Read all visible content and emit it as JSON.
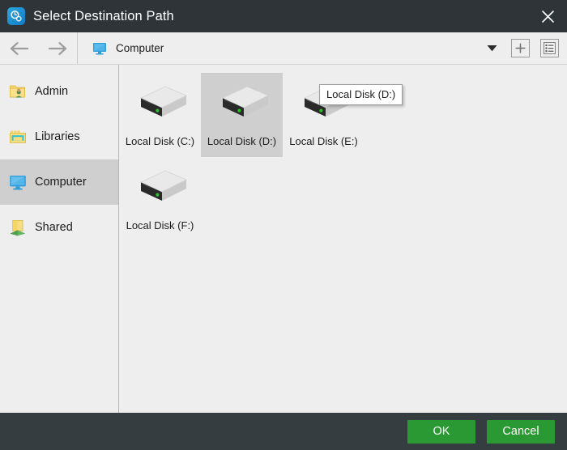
{
  "window": {
    "title": "Select Destination Path",
    "app_icon": "disk-clone-icon",
    "close_icon": "close-icon",
    "titlebar_color": "#2e3438"
  },
  "toolbar": {
    "back_icon": "arrow-left-icon",
    "forward_icon": "arrow-right-icon",
    "location_icon": "computer-monitor-icon",
    "location_text": "Computer",
    "dropdown_icon": "caret-down-icon",
    "new_folder_icon": "plus-icon",
    "view_mode_icon": "list-view-icon"
  },
  "sidebar": {
    "items": [
      {
        "label": "Admin",
        "icon": "user-folder-icon",
        "selected": false
      },
      {
        "label": "Libraries",
        "icon": "libraries-icon",
        "selected": false
      },
      {
        "label": "Computer",
        "icon": "computer-monitor-icon",
        "selected": true
      },
      {
        "label": "Shared",
        "icon": "shared-folder-icon",
        "selected": false
      }
    ],
    "selected_bg": "#cfcfcf"
  },
  "main": {
    "drives": [
      {
        "label": "Local Disk (C:)",
        "icon": "hard-disk-icon",
        "selected": false
      },
      {
        "label": "Local Disk (D:)",
        "icon": "hard-disk-icon",
        "selected": true
      },
      {
        "label": "Local Disk (E:)",
        "icon": "hard-disk-icon",
        "selected": false
      },
      {
        "label": "Local Disk (F:)",
        "icon": "hard-disk-icon",
        "selected": false
      }
    ],
    "tooltip": "Local Disk (D:)"
  },
  "footer": {
    "ok_label": "OK",
    "cancel_label": "Cancel",
    "bg_color": "#363d41",
    "button_color": "#2a9933"
  }
}
